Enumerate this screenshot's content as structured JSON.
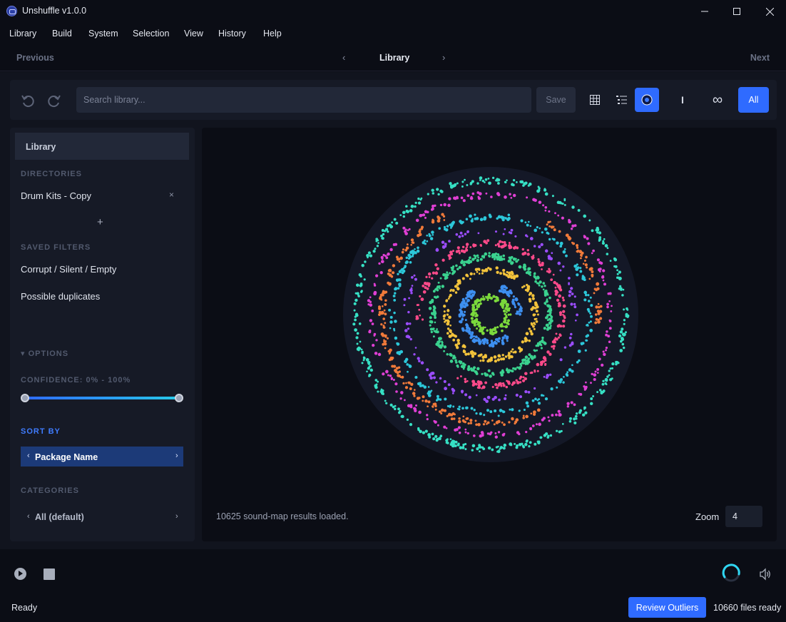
{
  "window": {
    "title": "Unshuffle v1.0.0",
    "minimize": "—",
    "maximize": "☐",
    "close": "✕"
  },
  "menu": [
    "Library",
    "Build",
    "System",
    "Selection",
    "View",
    "History",
    "Help"
  ],
  "nav": {
    "previous": "Previous",
    "title": "Library",
    "next": "Next",
    "left_chev": "‹",
    "right_chev": "›"
  },
  "toolbar": {
    "search_placeholder": "Search library...",
    "save_label": "Save",
    "all_label": "All",
    "cursor_mode_label": "I",
    "loop_label": "∞",
    "icons": [
      "undo-icon",
      "redo-icon",
      "grid-view-icon",
      "list-view-icon",
      "sound-map-icon"
    ]
  },
  "sidebar": {
    "library_label": "Library",
    "directories_heading": "DIRECTORIES",
    "directories": [
      "Drum Kits - Copy"
    ],
    "remove_symbol": "×",
    "add_symbol": "+",
    "saved_filters_heading": "SAVED FILTERS",
    "saved_filters": [
      "Corrupt / Silent / Empty",
      "Possible duplicates"
    ],
    "options_heading": "▾ OPTIONS",
    "confidence_label": "CONFIDENCE: 0% - 100%",
    "confidence_min": 0,
    "confidence_max": 100,
    "sort_heading": "SORT BY",
    "sort_value": "Package Name",
    "categories_heading": "CATEGORIES",
    "category_value": "All (default)",
    "chev_left": "‹",
    "chev_right": "›"
  },
  "map": {
    "status": "10625 sound-map results loaded.",
    "zoom_label": "Zoom",
    "zoom_value": "4",
    "ring_colors": [
      "#7bd93c",
      "#3d8ff0",
      "#f2c23b",
      "#3ad28f",
      "#ff4a8a",
      "#9b4dff",
      "#2cc7d9",
      "#f07a3a",
      "#df3fd4",
      "#36e0c4"
    ]
  },
  "status": {
    "ready": "Ready",
    "review_label": "Review Outliers",
    "files_ready": "10660 files ready"
  },
  "colors": {
    "accent": "#2f6bff",
    "bg": "#0c0e16",
    "panel": "#161a26"
  }
}
